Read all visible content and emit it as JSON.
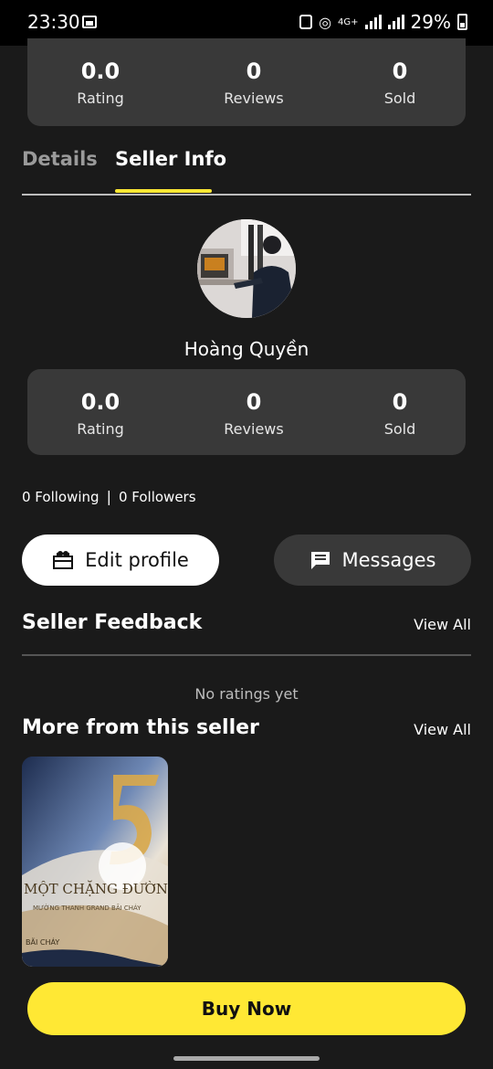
{
  "status_bar": {
    "time": "23:30",
    "network": "4G+",
    "battery": "29%"
  },
  "top_stats": [
    {
      "value": "0.0",
      "label": "Rating"
    },
    {
      "value": "0",
      "label": "Reviews"
    },
    {
      "value": "0",
      "label": "Sold"
    }
  ],
  "tabs": [
    {
      "label": "Details",
      "active": false
    },
    {
      "label": "Seller Info",
      "active": true
    }
  ],
  "seller": {
    "name": "Hoàng Quyền",
    "stats": [
      {
        "value": "0.0",
        "label": "Rating"
      },
      {
        "value": "0",
        "label": "Reviews"
      },
      {
        "value": "0",
        "label": "Sold"
      }
    ],
    "following": "0 Following",
    "followers": "0 Followers"
  },
  "actions": {
    "edit_profile": "Edit profile",
    "messages": "Messages"
  },
  "feedback": {
    "title": "Seller Feedback",
    "view_all": "View All",
    "empty": "No ratings yet"
  },
  "more": {
    "title": "More from this seller",
    "view_all": "View All"
  },
  "product_image_text": {
    "line1": "MỘT CHẶNG ĐƯỜNG",
    "line2": "MƯỜNG THANH GRAND BÃI CHÁY",
    "line3": "BÃI CHÁY"
  },
  "buy_now": "Buy Now",
  "colors": {
    "accent": "#ffe834",
    "background": "#1a1a1a",
    "card": "#393939"
  }
}
